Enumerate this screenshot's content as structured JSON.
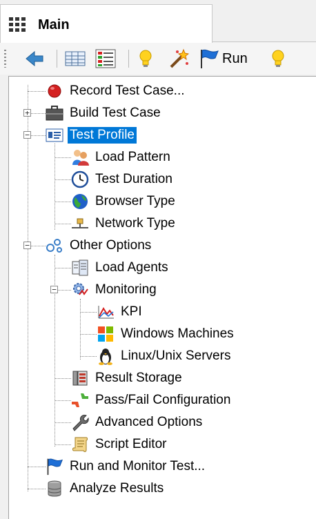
{
  "tab": {
    "label": "Main",
    "icon": "grid-icon"
  },
  "toolbar": {
    "buttons": [
      {
        "name": "back-arrow-icon"
      },
      {
        "name": "table-icon"
      },
      {
        "name": "colored-list-icon"
      },
      {
        "name": "lightbulb-icon"
      },
      {
        "name": "magic-wand-icon"
      }
    ],
    "run_label": "Run",
    "run_icon": "blue-flag-icon",
    "hint_icon": "lightbulb-icon"
  },
  "tree": {
    "record": "Record Test Case...",
    "build": "Build Test Case",
    "profile": "Test Profile",
    "load_pattern": "Load Pattern",
    "test_duration": "Test Duration",
    "browser_type": "Browser Type",
    "network_type": "Network Type",
    "other_options": "Other Options",
    "load_agents": "Load Agents",
    "monitoring": "Monitoring",
    "kpi": "KPI",
    "windows_machines": "Windows Machines",
    "linux_servers": "Linux/Unix Servers",
    "result_storage": "Result Storage",
    "pass_fail": "Pass/Fail Configuration",
    "advanced_options": "Advanced Options",
    "script_editor": "Script Editor",
    "run_monitor": "Run and Monitor Test...",
    "analyze_results": "Analyze Results"
  },
  "colors": {
    "selection": "#0078d7",
    "flag": "#1e6fd6",
    "record": "#d42020"
  }
}
